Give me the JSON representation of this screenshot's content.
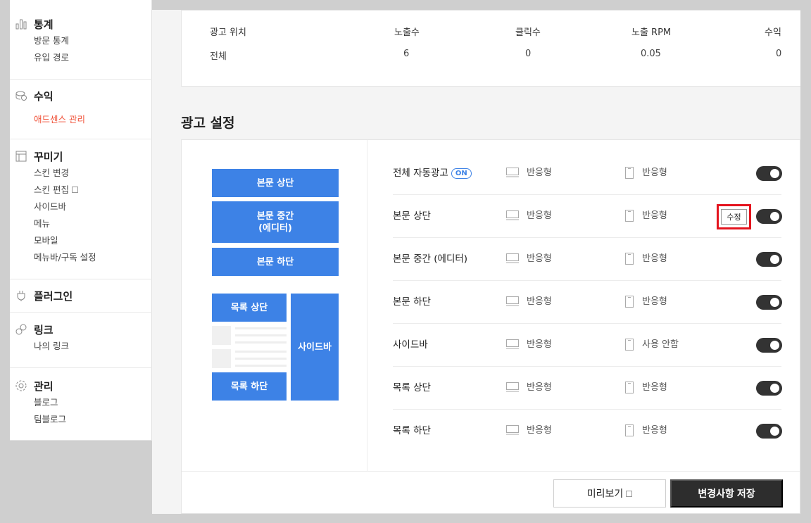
{
  "sidebar": {
    "groups": [
      {
        "title": "통계",
        "icon": "chart-bars-icon",
        "items": [
          "방문 통계",
          "유입 경로"
        ]
      },
      {
        "title": "수익",
        "icon": "coins-icon",
        "items": [
          "애드센스 관리"
        ],
        "active": "애드센스 관리"
      },
      {
        "title": "꾸미기",
        "icon": "layout-icon",
        "items": [
          "스킨 변경",
          "스킨 편집",
          "사이드바",
          "메뉴",
          "모바일",
          "메뉴바/구독 설정"
        ]
      },
      {
        "title": "플러그인",
        "icon": "plug-icon",
        "items": []
      },
      {
        "title": "링크",
        "icon": "link-icon",
        "items": [
          "나의 링크"
        ]
      },
      {
        "title": "관리",
        "icon": "gear-icon",
        "items": [
          "블로그",
          "팀블로그"
        ]
      }
    ]
  },
  "stats": {
    "headers": [
      "광고 위치",
      "노출수",
      "클릭수",
      "노출 RPM",
      "수익"
    ],
    "row": [
      "전체",
      "6",
      "0",
      "0.05",
      "0"
    ]
  },
  "ad_settings": {
    "title": "광고 설정",
    "preview": {
      "top": "본문 상단",
      "middle_line1": "본문 중간",
      "middle_line2": "(에디터)",
      "bottom": "본문 하단",
      "list_top": "목록 상단",
      "list_bottom": "목록 하단",
      "sidebar": "사이드바"
    },
    "on_badge": "ON",
    "edit_label": "수정",
    "rows": [
      {
        "name": "전체 자동광고",
        "pc": "반응형",
        "mobile": "반응형",
        "enabled": true
      },
      {
        "name": "본문 상단",
        "pc": "반응형",
        "mobile": "반응형",
        "enabled": true
      },
      {
        "name": "본문 중간 (에디터)",
        "pc": "반응형",
        "mobile": "반응형",
        "enabled": true
      },
      {
        "name": "본문 하단",
        "pc": "반응형",
        "mobile": "반응형",
        "enabled": true
      },
      {
        "name": "사이드바",
        "pc": "반응형",
        "mobile": "사용 안함",
        "enabled": true
      },
      {
        "name": "목록 상단",
        "pc": "반응형",
        "mobile": "반응형",
        "enabled": true
      },
      {
        "name": "목록 하단",
        "pc": "반응형",
        "mobile": "반응형",
        "enabled": true
      }
    ],
    "preview_button": "미리보기",
    "save_button": "변경사항 저장"
  },
  "colors": {
    "accent": "#3d82e6",
    "active": "#f0533a",
    "highlight": "#e4141e"
  }
}
